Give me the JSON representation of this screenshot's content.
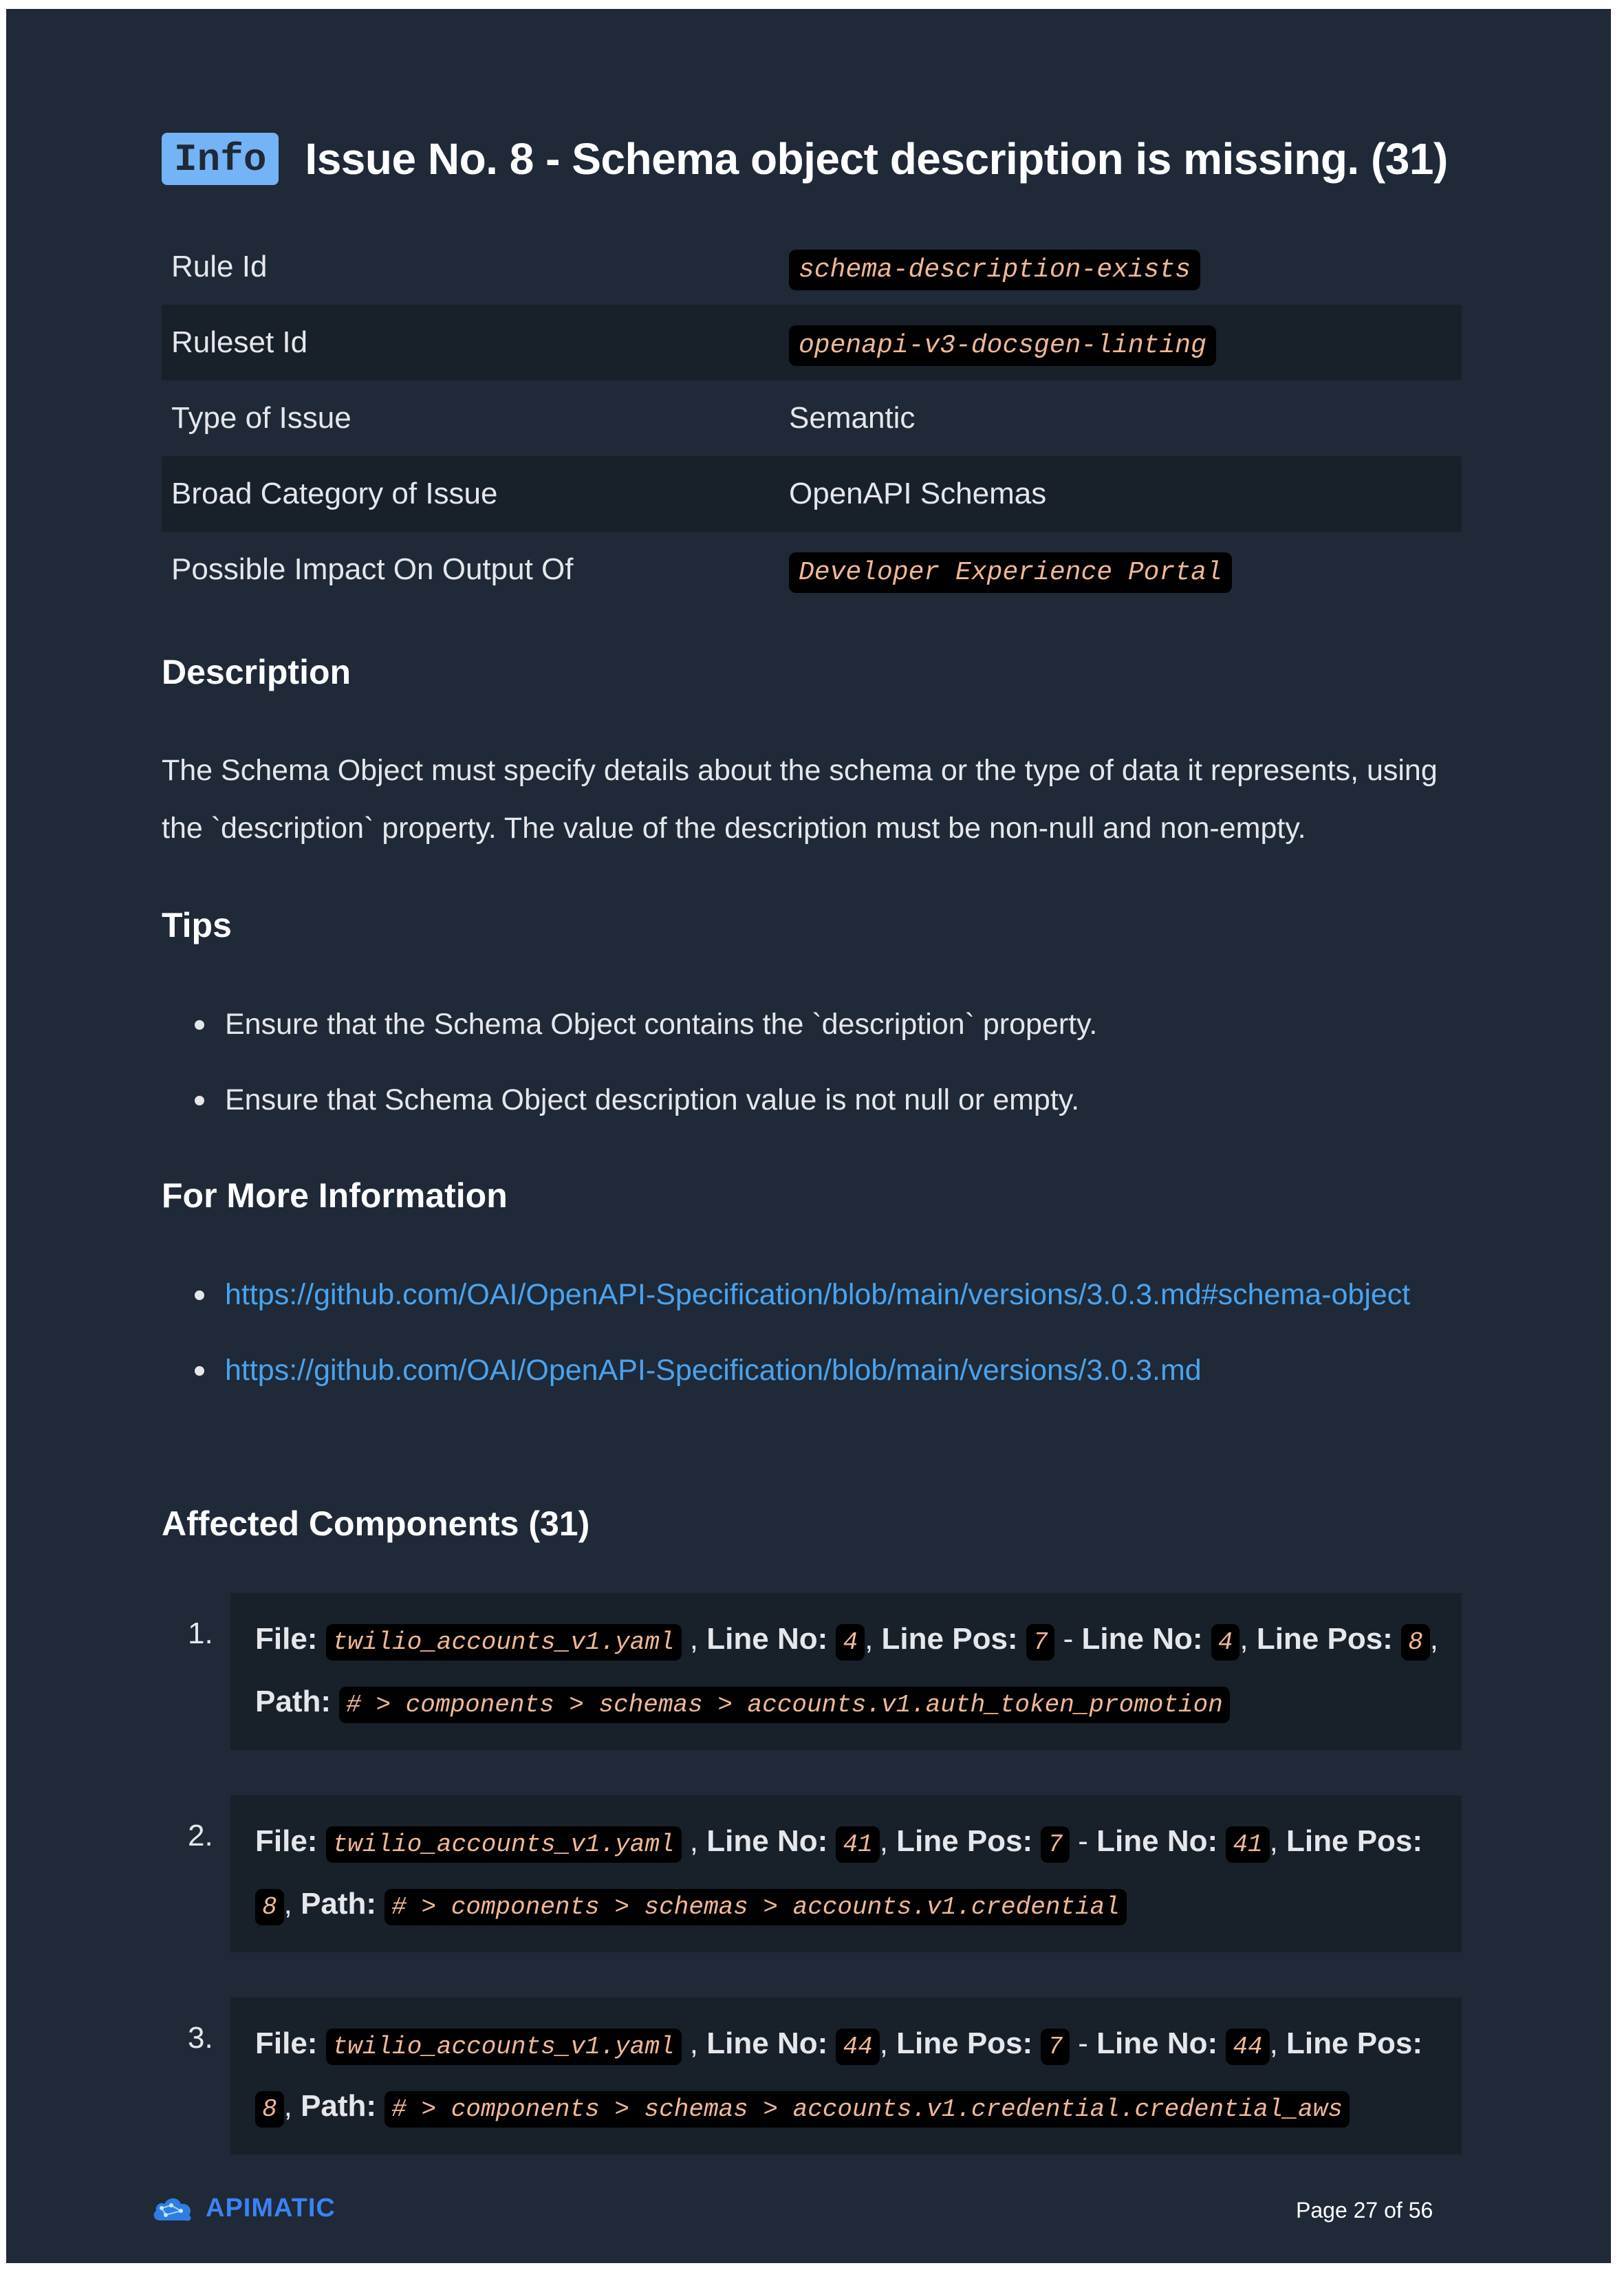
{
  "issue": {
    "badge": "Info",
    "title": "Issue No. 8 - Schema object description is missing. (31)"
  },
  "meta_rows": [
    {
      "label": "Rule Id",
      "value": "schema-description-exists",
      "is_code": true
    },
    {
      "label": "Ruleset Id",
      "value": "openapi-v3-docsgen-linting",
      "is_code": true
    },
    {
      "label": "Type of Issue",
      "value": "Semantic",
      "is_code": false
    },
    {
      "label": "Broad Category of Issue",
      "value": "OpenAPI Schemas",
      "is_code": false
    },
    {
      "label": "Possible Impact On Output Of",
      "value": "Developer Experience Portal",
      "is_code": true
    }
  ],
  "description": {
    "heading": "Description",
    "text": "The Schema Object must specify details about the schema or the type of data it represents, using the `description` property. The value of the description must be non-null and non-empty."
  },
  "tips": {
    "heading": "Tips",
    "items": [
      "Ensure that the Schema Object contains the `description` property.",
      "Ensure that Schema Object description value is not null or empty."
    ]
  },
  "more_info": {
    "heading": "For More Information",
    "links": [
      "https://github.com/OAI/OpenAPI-Specification/blob/main/versions/3.0.3.md#schema-object",
      "https://github.com/OAI/OpenAPI-Specification/blob/main/versions/3.0.3.md"
    ]
  },
  "affected": {
    "heading": "Affected Components (31)",
    "labels": {
      "file": "File:",
      "line_no": "Line No:",
      "line_pos": "Line Pos:",
      "path": "Path:"
    },
    "items": [
      {
        "num": "1.",
        "file": "twilio_accounts_v1.yaml",
        "start_line": "4",
        "start_pos": "7",
        "end_line": "4",
        "end_pos": "8",
        "path": "# > components > schemas > accounts.v1.auth_token_promotion"
      },
      {
        "num": "2.",
        "file": "twilio_accounts_v1.yaml",
        "start_line": "41",
        "start_pos": "7",
        "end_line": "41",
        "end_pos": "8",
        "path": "# > components > schemas > accounts.v1.credential"
      },
      {
        "num": "3.",
        "file": "twilio_accounts_v1.yaml",
        "start_line": "44",
        "start_pos": "7",
        "end_line": "44",
        "end_pos": "8",
        "path": "# > components > schemas > accounts.v1.credential.credential_aws"
      }
    ]
  },
  "footer": {
    "logo_text": "APIMATIC",
    "page": "Page 27 of 56"
  },
  "colors": {
    "background": "#1f2937",
    "badge": "#74b3f6",
    "link": "#4aa3ef",
    "code_text": "#f0b896",
    "brand": "#3b82f6"
  }
}
